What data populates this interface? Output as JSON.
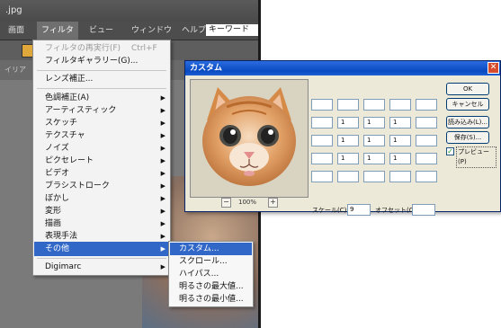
{
  "app": {
    "title": ".jpg",
    "menu": [
      "画面",
      "フィルタ",
      "ビュー",
      "ウィンドウ",
      "ヘルプ"
    ],
    "search_value": "キーワード",
    "panel_label": "イリア"
  },
  "filter_menu": {
    "repeat": {
      "label": "フィルタの再実行(F)",
      "shortcut": "Ctrl+F"
    },
    "gallery": "フィルタギャラリー(G)...",
    "lens": "レンズ補正...",
    "items": [
      "色調補正(A)",
      "アーティスティック",
      "スケッチ",
      "テクスチャ",
      "ノイズ",
      "ピクセレート",
      "ビデオ",
      "ブラシストローク",
      "ぼかし",
      "変形",
      "描画",
      "表現手法",
      "その他"
    ],
    "digimarc": "Digimarc"
  },
  "submenu": [
    "カスタム...",
    "スクロール...",
    "ハイパス...",
    "明るさの最大値...",
    "明るさの最小値..."
  ],
  "dialog": {
    "title": "カスタム",
    "zoom": "100%",
    "matrix": [
      [
        "",
        "",
        "",
        "",
        ""
      ],
      [
        "",
        "1",
        "1",
        "1",
        ""
      ],
      [
        "",
        "1",
        "1",
        "1",
        ""
      ],
      [
        "",
        "1",
        "1",
        "1",
        ""
      ],
      [
        "",
        "",
        "",
        "",
        ""
      ]
    ],
    "scale_label": "スケール(C):",
    "scale_value": "9",
    "offset_label": "オフセット(O):",
    "offset_value": "",
    "buttons": {
      "ok": "OK",
      "cancel": "キャンセル",
      "load": "読み込み(L)...",
      "save": "保存(S)..."
    },
    "preview_label": "プレビュー(P)",
    "preview_checked": true
  }
}
